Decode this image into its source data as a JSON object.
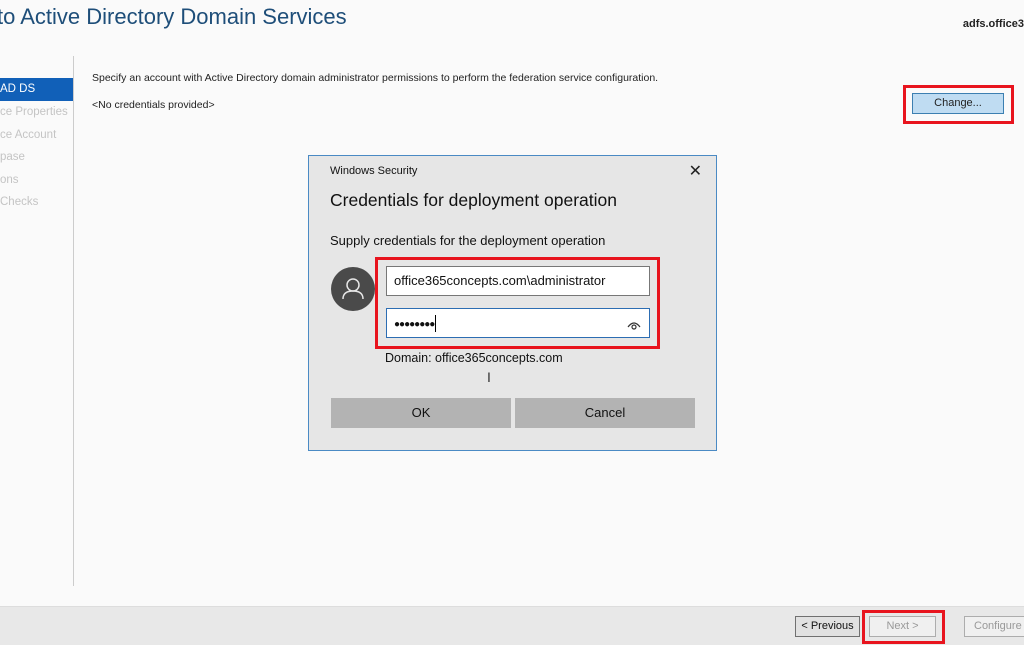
{
  "window": {
    "title": "to Active Directory Domain Services",
    "server_name": "adfs.office3"
  },
  "nav": {
    "items": [
      {
        "label": "AD DS",
        "active": true
      },
      {
        "label": "ce Properties",
        "active": false
      },
      {
        "label": "ce Account",
        "active": false
      },
      {
        "label": "pase",
        "active": false
      },
      {
        "label": "ons",
        "active": false
      },
      {
        "label": " Checks",
        "active": false
      }
    ]
  },
  "main": {
    "description": "Specify an account with Active Directory domain administrator permissions to perform the federation service configuration.",
    "credentials_status": "<No credentials provided>",
    "change_label": "Change..."
  },
  "footer": {
    "previous_label": "< Previous",
    "next_label": "Next >",
    "configure_label": "Configure"
  },
  "dialog": {
    "window_title": "Windows Security",
    "close_glyph": "✕",
    "heading": "Credentials for deployment operation",
    "subheading": "Supply credentials for the deployment operation",
    "username_value": "office365concepts.com\\administrator",
    "password_value": "●●●●●●●●",
    "domain_text": "Domain: office365concepts.com",
    "ok_label": "OK",
    "cancel_label": "Cancel",
    "cursor_glyph": "I"
  },
  "highlight_color": "#e8141e"
}
